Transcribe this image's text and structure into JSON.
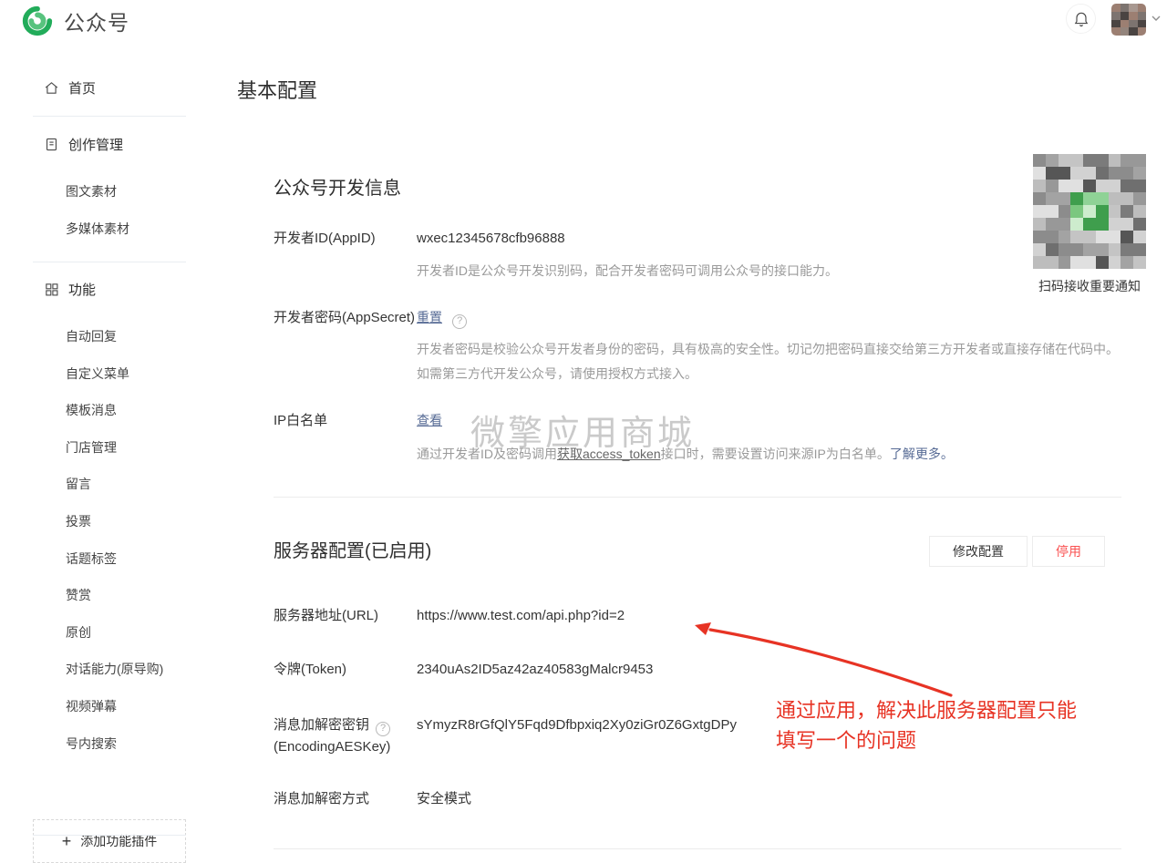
{
  "header": {
    "brand": "公众号"
  },
  "sidebar": {
    "home_label": "首页",
    "groups": [
      {
        "label": "创作管理",
        "items": [
          "图文素材",
          "多媒体素材"
        ]
      },
      {
        "label": "功能",
        "items": [
          "自动回复",
          "自定义菜单",
          "模板消息",
          "门店管理",
          "留言",
          "投票",
          "话题标签",
          "赞赏",
          "原创",
          "对话能力(原导购)",
          "视频弹幕",
          "号内搜索"
        ]
      }
    ],
    "add_plugin_label": "添加功能插件"
  },
  "page": {
    "title": "基本配置"
  },
  "qr_panel": {
    "caption": "扫码接收重要通知"
  },
  "watermark": "微擎应用商城",
  "dev_info": {
    "title": "公众号开发信息",
    "appid": {
      "label": "开发者ID(AppID)",
      "value": "wxec12345678cfb96888",
      "desc": "开发者ID是公众号开发识别码，配合开发者密码可调用公众号的接口能力。"
    },
    "secret": {
      "label": "开发者密码(AppSecret)",
      "reset_link": "重置",
      "desc": "开发者密码是校验公众号开发者身份的密码，具有极高的安全性。切记勿把密码直接交给第三方开发者或直接存储在代码中。如需第三方代开发公众号，请使用授权方式接入。"
    },
    "ip_whitelist": {
      "label": "IP白名单",
      "view_link": "查看",
      "desc_prefix": "通过开发者ID及密码调用",
      "token_link": "获取access_token",
      "desc_suffix": "接口时，需要设置访问来源IP为白名单。",
      "more_link": "了解更多。"
    }
  },
  "server_config": {
    "title": "服务器配置(已启用)",
    "modify_button": "修改配置",
    "disable_button": "停用",
    "url": {
      "label": "服务器地址(URL)",
      "value": "https://www.test.com/api.php?id=2"
    },
    "token": {
      "label": "令牌(Token)",
      "value": "2340uAs2ID5az42az40583gMalcr9453"
    },
    "aes_key": {
      "label_line1": "消息加解密密钥",
      "label_line2": "(EncodingAESKey)",
      "value": "sYmyzR8rGfQlY5Fqd9Dfbpxiq2Xy0ziGr0Z6GxtgDPy"
    },
    "mode": {
      "label": "消息加解密方式",
      "value": "安全模式"
    }
  },
  "annotation": {
    "line1": "通过应用，解决此服务器配置只能",
    "line2": "填写一个的问题"
  },
  "colors": {
    "brand_green": "#22ac5a",
    "link_blue": "#576b95",
    "annotation_red": "#e73324",
    "disable_red": "#fa5151"
  }
}
